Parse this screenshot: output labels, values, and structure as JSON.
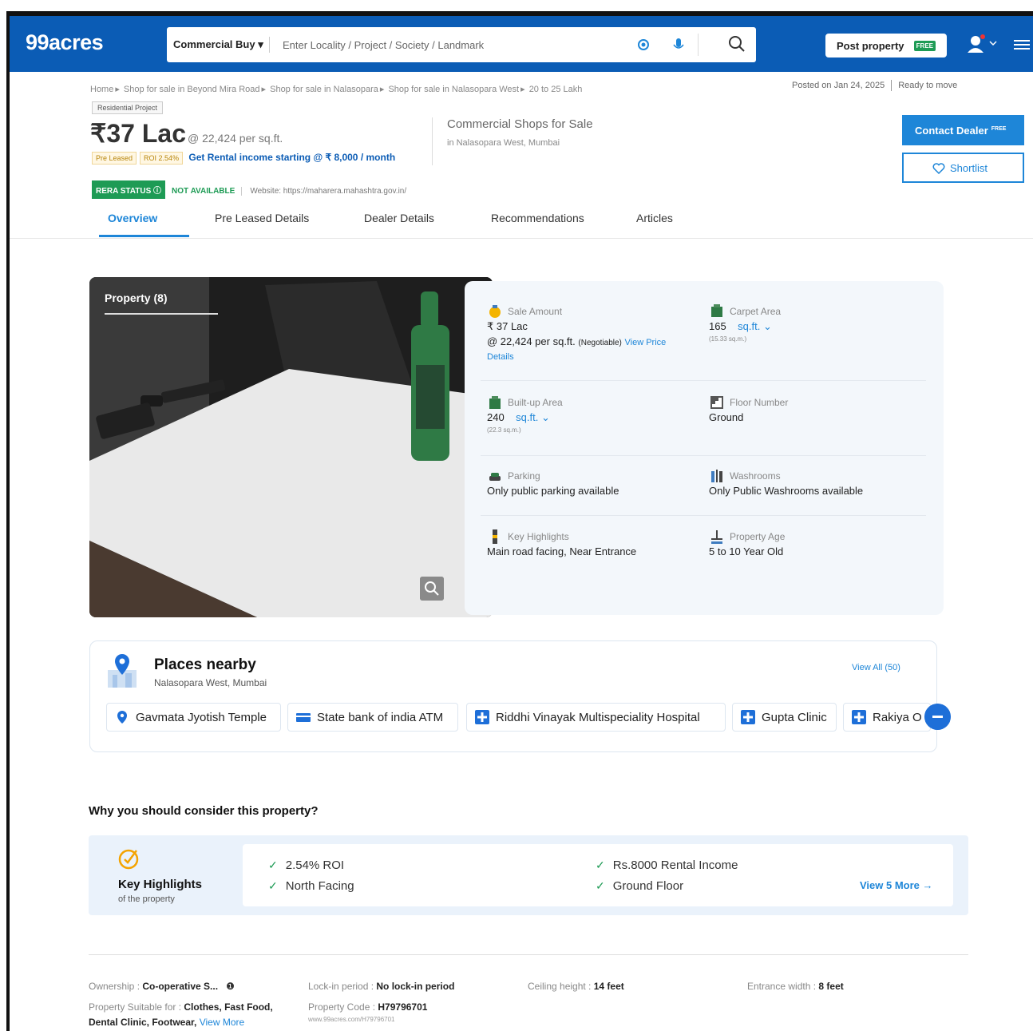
{
  "header": {
    "logo": "99acres",
    "search_type": "Commercial Buy",
    "search_placeholder": "Enter Locality / Project / Society / Landmark",
    "post_property": "Post property",
    "free_badge": "FREE"
  },
  "breadcrumbs": [
    "Home",
    "Shop for sale in Beyond Mira Road",
    "Shop for sale in Nalasopara",
    "Shop for sale in Nalasopara West",
    "20 to 25 Lakh"
  ],
  "posted": "Posted on Jan 24, 2025",
  "ready": "Ready to move",
  "listing": {
    "project_tag": "Residential Project",
    "price": "37 Lac",
    "price_symbol": "₹",
    "price_per_sqft": "@ 22,424 per sq.ft.",
    "tag_preleased": "Pre Leased",
    "tag_roi": "ROI 2.54%",
    "rental_link": "Get Rental income starting @ ₹ 8,000 / month",
    "type": "Commercial Shops for Sale",
    "location": "in Nalasopara West, Mumbai",
    "rera_badge": "RERA STATUS",
    "rera_status": "NOT AVAILABLE",
    "website": "Website: https://maharera.mahashtra.gov.in/",
    "contact_label": "Contact Dealer",
    "contact_free": "FREE",
    "shortlist_label": "Shortlist"
  },
  "tabs": [
    "Overview",
    "Pre Leased Details",
    "Dealer Details",
    "Recommendations",
    "Articles"
  ],
  "photo": {
    "label": "Property (8)"
  },
  "details": {
    "sale_amount_label": "Sale Amount",
    "sale_amount": "₹ 37 Lac",
    "sale_per_sqft": "@ 22,424 per sq.ft.",
    "negotiable": "(Negotiable)",
    "view_price": "View Price",
    "details_link": "Details",
    "carpet_label": "Carpet Area",
    "carpet_value": "165",
    "carpet_unit": "sq.ft.",
    "carpet_sub": "(15.33 sq.m.)",
    "builtup_label": "Built-up Area",
    "builtup_value": "240",
    "builtup_unit": "sq.ft.",
    "builtup_sub": "(22.3 sq.m.)",
    "floor_label": "Floor Number",
    "floor_value": "Ground",
    "parking_label": "Parking",
    "parking_value": "Only public parking available",
    "washrooms_label": "Washrooms",
    "washrooms_value": "Only Public Washrooms available",
    "highlights_label": "Key Highlights",
    "highlights_value": "Main road facing, Near Entrance",
    "age_label": "Property Age",
    "age_value": "5 to 10 Year Old"
  },
  "nearby": {
    "title": "Places nearby",
    "subtitle": "Nalasopara West, Mumbai",
    "view_all": "View All (50)",
    "chips": [
      "Gavmata Jyotish Temple",
      "State bank of india ATM",
      "Riddhi Vinayak Multispeciality Hospital",
      "Gupta Clinic",
      "Rakiya O"
    ]
  },
  "why": {
    "heading": "Why you should consider this property?",
    "kh_title": "Key Highlights",
    "kh_sub": "of the property",
    "items": [
      "2.54% ROI",
      "Rs.8000 Rental Income",
      "North Facing",
      "Ground Floor"
    ],
    "view_more": "View 5 More →"
  },
  "facts": {
    "ownership_label": "Ownership : ",
    "ownership": "Co-operative S...",
    "lockin_label": "Lock-in period : ",
    "lockin": "No lock-in period",
    "ceiling_label": "Ceiling height : ",
    "ceiling": "14 feet",
    "entrance_label": "Entrance width : ",
    "entrance": "8 feet",
    "suitable_label": "Property Suitable for : ",
    "suitable": "Clothes, Fast Food,",
    "suitable2": "Dental Clinic, Footwear, ",
    "view_more": "View More",
    "code_label": "Property Code : ",
    "code": "H79796701",
    "url": "www.99acres.com/H79796701"
  },
  "colors": {
    "brand": "#0b5cb5",
    "accent": "#1e86d8",
    "green": "#1e9b55"
  }
}
